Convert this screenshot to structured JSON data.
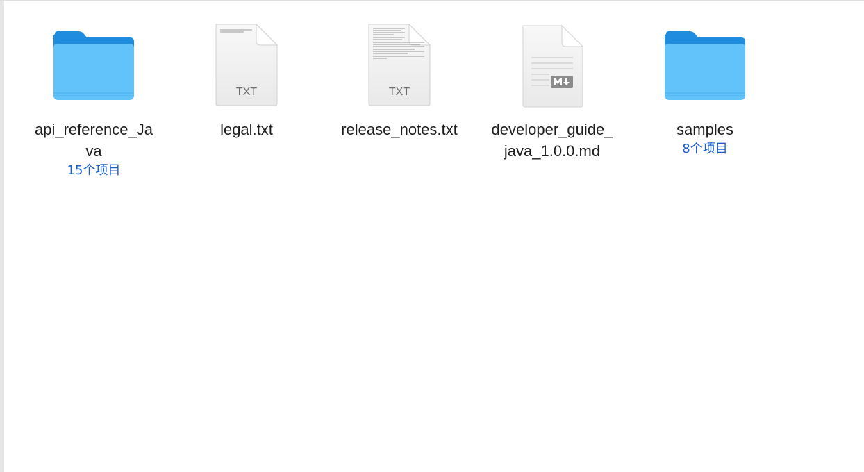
{
  "files": [
    {
      "name": "api_reference_Java",
      "line1": "api_reference_Ja",
      "line2": "va",
      "kind": "folder-icon",
      "subtitle": "15个项目"
    },
    {
      "name": "legal.txt",
      "line1": "legal.txt",
      "line2": "",
      "kind": "txt-file-icon",
      "badge": "TXT",
      "subtitle": ""
    },
    {
      "name": "release_notes.txt",
      "line1": "release_notes.txt",
      "line2": "",
      "kind": "txt-file-icon",
      "badge": "TXT",
      "subtitle": ""
    },
    {
      "name": "developer_guide_java_1.0.0.md",
      "line1": "developer_guide_",
      "line2": "java_1.0.0.md",
      "kind": "markdown-file-icon",
      "subtitle": ""
    },
    {
      "name": "samples",
      "line1": "samples",
      "line2": "",
      "kind": "folder-icon",
      "subtitle": "8个项目"
    }
  ],
  "colors": {
    "folder_back": "#1f8ce0",
    "folder_front": "#62c3fb",
    "item_count": "#1a5fcc",
    "label": "#1d1d1f"
  }
}
